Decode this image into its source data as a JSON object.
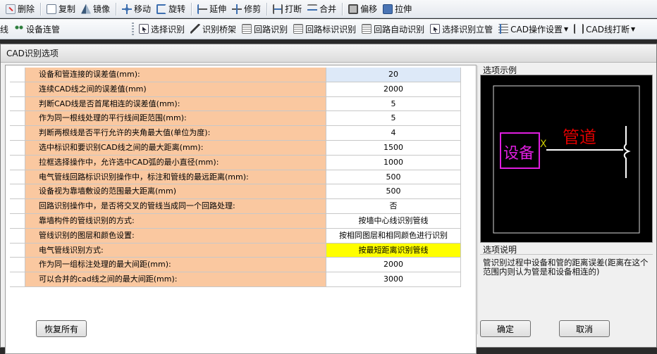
{
  "toolbar1": {
    "items": [
      {
        "label": "删除",
        "icon": "delete-icon"
      },
      {
        "label": "复制",
        "icon": "copy-icon"
      },
      {
        "label": "镜像",
        "icon": "mirror-icon"
      },
      {
        "label": "移动",
        "icon": "move-icon"
      },
      {
        "label": "旋转",
        "icon": "rotate-icon"
      },
      {
        "label": "延伸",
        "icon": "extend-icon"
      },
      {
        "label": "修剪",
        "icon": "trim-icon"
      },
      {
        "label": "打断",
        "icon": "break-icon"
      },
      {
        "label": "合并",
        "icon": "merge-icon"
      },
      {
        "label": "偏移",
        "icon": "offset-icon"
      },
      {
        "label": "拉伸",
        "icon": "stretch-icon"
      }
    ]
  },
  "toolbar2": {
    "items": [
      {
        "label": "线",
        "icon": ""
      },
      {
        "label": "设备连管",
        "icon": "device-connect-icon"
      },
      {
        "label": "选择识别",
        "icon": "select-recognize-icon"
      },
      {
        "label": "识别桥架",
        "icon": "bridge-icon"
      },
      {
        "label": "回路识别",
        "icon": "loop-icon"
      },
      {
        "label": "回路标识识别",
        "icon": "loop-label-icon"
      },
      {
        "label": "回路自动识别",
        "icon": "loop-auto-icon"
      },
      {
        "label": "选择识别立管",
        "icon": "riser-icon"
      },
      {
        "label": "CAD操作设置",
        "icon": "cad-settings-icon"
      },
      {
        "label": "CAD线打断",
        "icon": "cad-break-icon"
      }
    ]
  },
  "dialog": {
    "title": "CAD识别选项",
    "rows": [
      {
        "label": "设备和管连接的误差值(mm):",
        "value": "20",
        "state": "selected"
      },
      {
        "label": "连续CAD线之间的误差值(mm)",
        "value": "2000",
        "state": ""
      },
      {
        "label": "判断CAD线是否首尾相连的误差值(mm):",
        "value": "5",
        "state": ""
      },
      {
        "label": "作为同一根线处理的平行线间距范围(mm):",
        "value": "5",
        "state": ""
      },
      {
        "label": "判断两根线是否平行允许的夹角最大值(单位为度):",
        "value": "4",
        "state": ""
      },
      {
        "label": "选中标识和要识别CAD线之间的最大距离(mm):",
        "value": "1500",
        "state": ""
      },
      {
        "label": "拉框选择操作中，允许选中CAD弧的最小直径(mm):",
        "value": "1000",
        "state": ""
      },
      {
        "label": "电气管线回路标识识别操作中，标注和管线的最远距离(mm):",
        "value": "500",
        "state": ""
      },
      {
        "label": "设备视为靠墙敷设的范围最大距离(mm)",
        "value": "500",
        "state": ""
      },
      {
        "label": "回路识别操作中，是否将交叉的管线当成同一个回路处理:",
        "value": "否",
        "state": ""
      },
      {
        "label": "靠墙构件的管线识别的方式:",
        "value": "按墙中心线识别管线",
        "state": ""
      },
      {
        "label": "管线识别的图层和颜色设置:",
        "value": "按相同图层和相同颜色进行识别",
        "state": ""
      },
      {
        "label": "电气管线识别方式:",
        "value": "按最短距离识别管线",
        "state": "highlight"
      },
      {
        "label": "作为同一组标注处理的最大间距(mm):",
        "value": "2000",
        "state": ""
      },
      {
        "label": "可以合并的cad线之间的最大间距(mm):",
        "value": "3000",
        "state": ""
      }
    ],
    "preview_label": "选项示例",
    "preview": {
      "device_text": "设备",
      "pipe_text": "管道",
      "marker_text": "X"
    },
    "desc_label": "选项说明",
    "description": "管识别过程中设备和管的距离误差(距离在这个范围内则认为管是和设备相连的)",
    "buttons": {
      "restore": "恢复所有",
      "ok": "确定",
      "cancel": "取消"
    }
  },
  "colors": {
    "label_bg": "#fac8a0",
    "highlight": "#ffff00",
    "device": "#e01ee0",
    "pipe_text": "#e00000",
    "marker": "#c8c800"
  }
}
